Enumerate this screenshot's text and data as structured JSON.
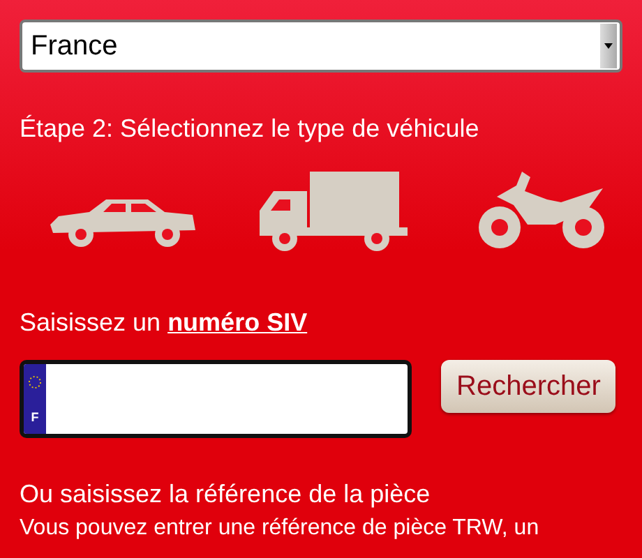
{
  "country_select": {
    "value": "France"
  },
  "step_heading": "Étape 2: Sélectionnez le type de véhicule",
  "vehicles": [
    {
      "kind": "car"
    },
    {
      "kind": "truck"
    },
    {
      "kind": "motorbike"
    }
  ],
  "siv": {
    "prefix": "Saisissez un",
    "link": "numéro SIV",
    "plate_country": "F",
    "button": "Rechercher"
  },
  "part_heading": "Ou saisissez la référence de la pièce",
  "part_text": "Vous pouvez entrer une référence de pièce TRW, un"
}
